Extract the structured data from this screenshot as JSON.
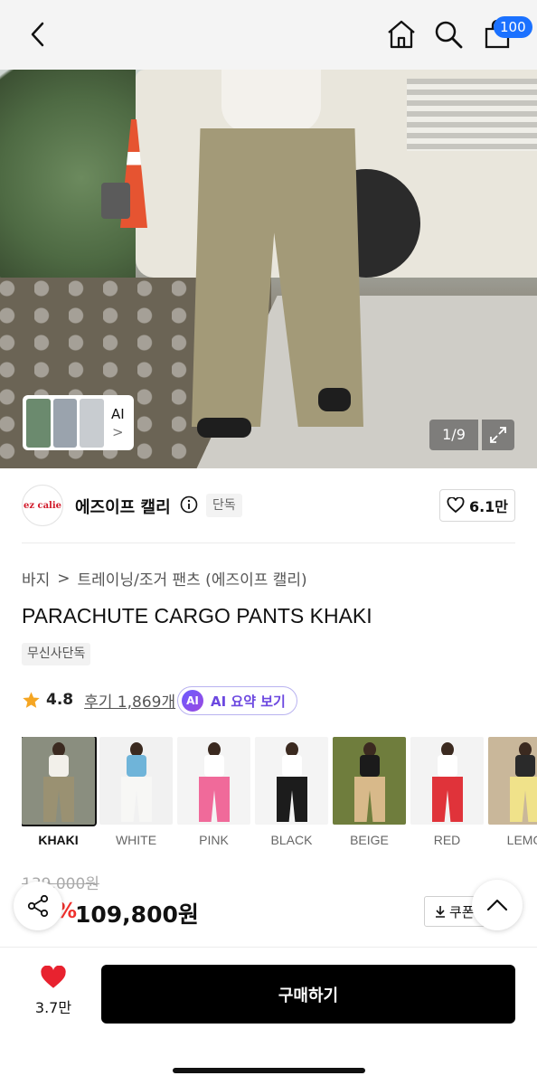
{
  "header": {
    "cart_count": "100"
  },
  "gallery": {
    "counter": "1/9",
    "ai_chip_label": "AI",
    "ai_chip_arrow": ">"
  },
  "brand": {
    "logo_text": "ez calie",
    "name": "에즈이프 캘리",
    "exclusive": "단독",
    "likes": "6.1만"
  },
  "breadcrumb": {
    "parent": "바지",
    "separator": ">",
    "child": "트레이닝/조거 팬츠 (에즈이프 캘리)"
  },
  "product": {
    "title": "PARACHUTE CARGO PANTS KHAKI",
    "tag": "무신사단독",
    "rating": "4.8",
    "reviews": "후기 1,869개",
    "ai_summary_badge": "AI",
    "ai_summary_label": "AI 요약 보기"
  },
  "colors": [
    {
      "name": "KHAKI",
      "selected": true,
      "bg": "#8a8e7f",
      "top": "#f2f0ea",
      "pants": "#9a9172"
    },
    {
      "name": "WHITE",
      "selected": false,
      "bg": "#f1f1f1",
      "top": "#6fb4d9",
      "pants": "#f7f7f5"
    },
    {
      "name": "PINK",
      "selected": false,
      "bg": "#f4f4f4",
      "top": "#ffffff",
      "pants": "#f06a9a"
    },
    {
      "name": "BLACK",
      "selected": false,
      "bg": "#f4f4f4",
      "top": "#ffffff",
      "pants": "#1c1c1c"
    },
    {
      "name": "BEIGE",
      "selected": false,
      "bg": "#6f7d3d",
      "top": "#1b1b1b",
      "pants": "#d8b98a"
    },
    {
      "name": "RED",
      "selected": false,
      "bg": "#f3f3f3",
      "top": "#ffffff",
      "pants": "#e0333a"
    },
    {
      "name": "LEMO",
      "selected": false,
      "bg": "#c9b79a",
      "top": "#2a2a2a",
      "pants": "#f0e28a"
    }
  ],
  "pricing": {
    "original": "139,000원",
    "discount": "21%",
    "price": "109,800원",
    "coupon": "쿠폰"
  },
  "bottom_bar": {
    "wish_count": "3.7만",
    "buy_label": "구매하기"
  },
  "accent_colors": {
    "brand_red": "#d11a2a",
    "badge_blue": "#1b71ff",
    "star": "#f5a623",
    "ai_purple": "#6c48e0",
    "heart_red": "#e8222f"
  }
}
